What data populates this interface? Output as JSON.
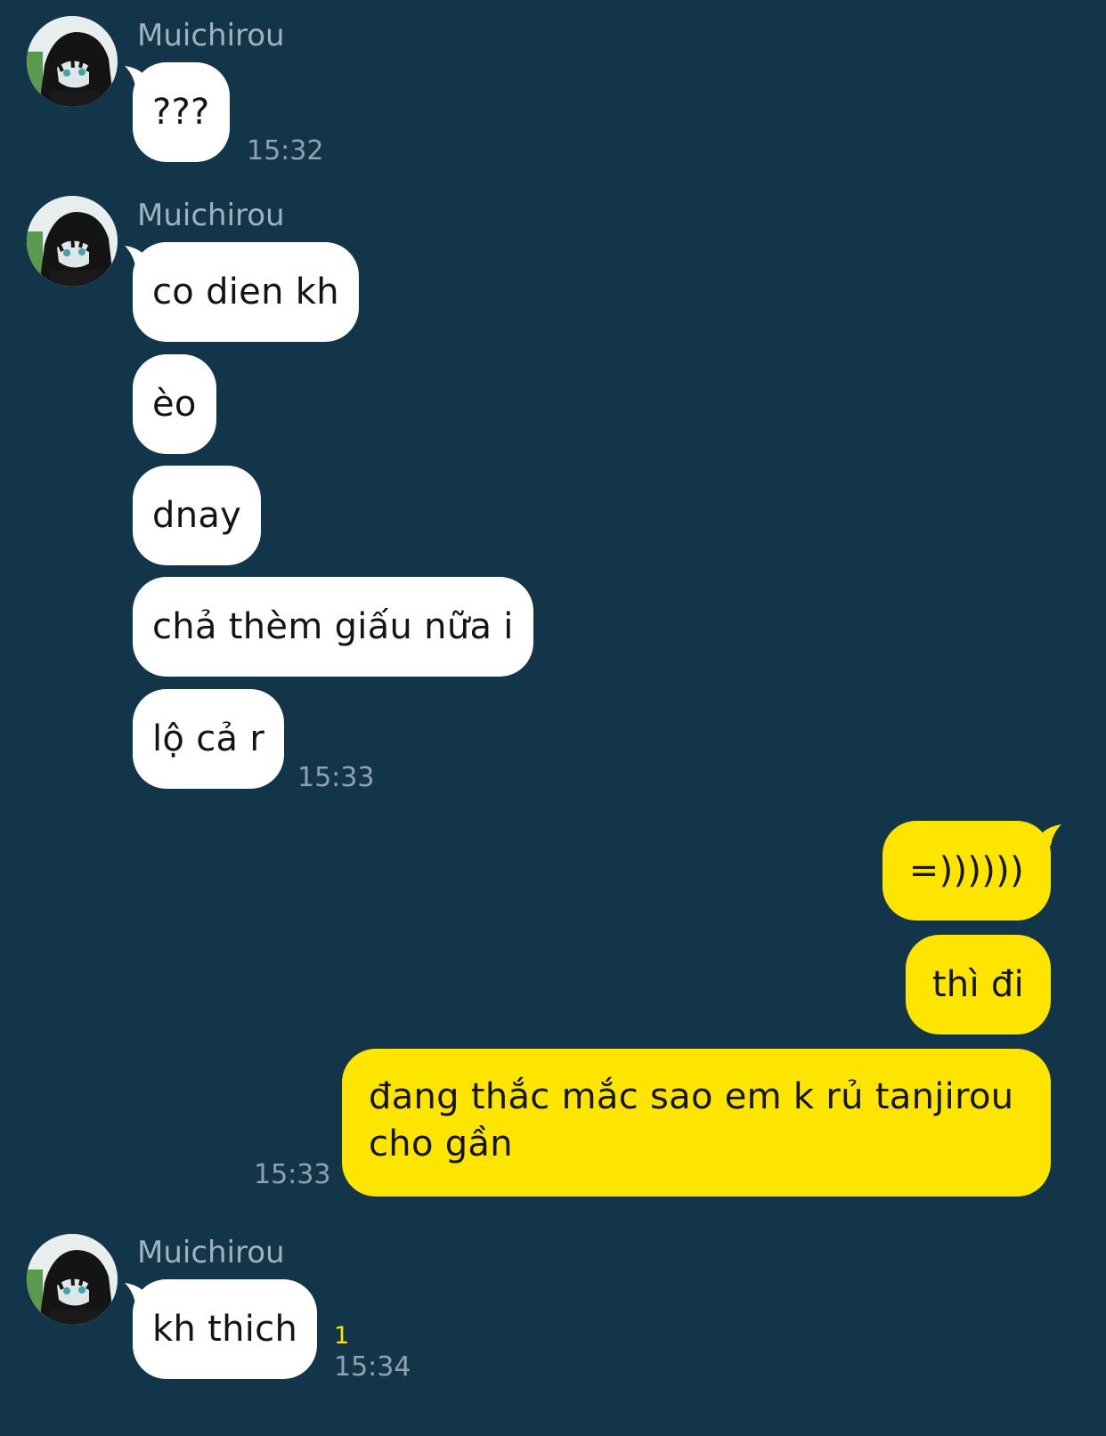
{
  "chat": {
    "contact_name": "Muichirou",
    "groups": [
      {
        "sender": "Muichirou",
        "messages": [
          "???"
        ],
        "time": "15:32"
      },
      {
        "sender": "Muichirou",
        "messages": [
          "co dien kh",
          "èo",
          "dnay",
          "chả thèm giấu nữa i",
          "lộ cả r"
        ],
        "time": "15:33"
      },
      {
        "sender": "me",
        "messages": [
          "=))))))",
          "thì đi",
          "đang thắc mắc sao em k rủ tanjirou cho gần"
        ],
        "time": "15:33"
      },
      {
        "sender": "Muichirou",
        "messages": [
          "kh thich"
        ],
        "time": "15:34",
        "unread_count": "1"
      }
    ]
  },
  "colors": {
    "background": "#12354a",
    "incoming_bubble": "#ffffff",
    "outgoing_bubble": "#fee500",
    "meta_text": "#8fa3ae",
    "unread_count": "#fee500"
  },
  "icons": {
    "avatar": "anime-profile-avatar"
  }
}
